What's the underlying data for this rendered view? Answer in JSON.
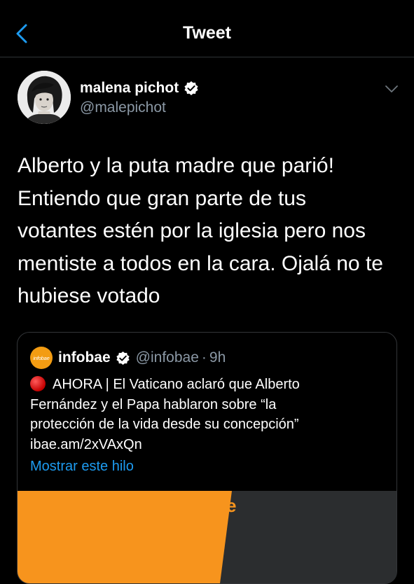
{
  "header": {
    "title": "Tweet",
    "back_icon": "chevron-left-icon",
    "accent_color": "#1d9bf0"
  },
  "tweet": {
    "author": {
      "name": "malena pichot",
      "handle": "@malepichot",
      "verified": true,
      "avatar_icon": "user-avatar"
    },
    "menu_icon": "chevron-down-icon",
    "text_lines": [
      "Alberto y la puta madre que parió!",
      "Entiendo que gran parte de tus",
      "votantes estén por la iglesia pero nos",
      "mentiste a todos en la cara. Ojalá no te",
      "hubiese votado"
    ]
  },
  "quoted_tweet": {
    "logo_text": "infobae",
    "author_name": "infobae",
    "verified": true,
    "handle": "@infobae",
    "separator": "·",
    "time": "9h",
    "text_lines": [
      "AHORA | El Vaticano aclaró que Alberto",
      "Fernández y el Papa hablaron sobre “la",
      "protección de la vida desde su concepción”",
      "ibae.am/2xVAxQn"
    ],
    "show_thread_label": "Mostrar este hilo",
    "media_letter": "e",
    "logo_color": "#f39c12",
    "media_color": "#f7941d"
  }
}
